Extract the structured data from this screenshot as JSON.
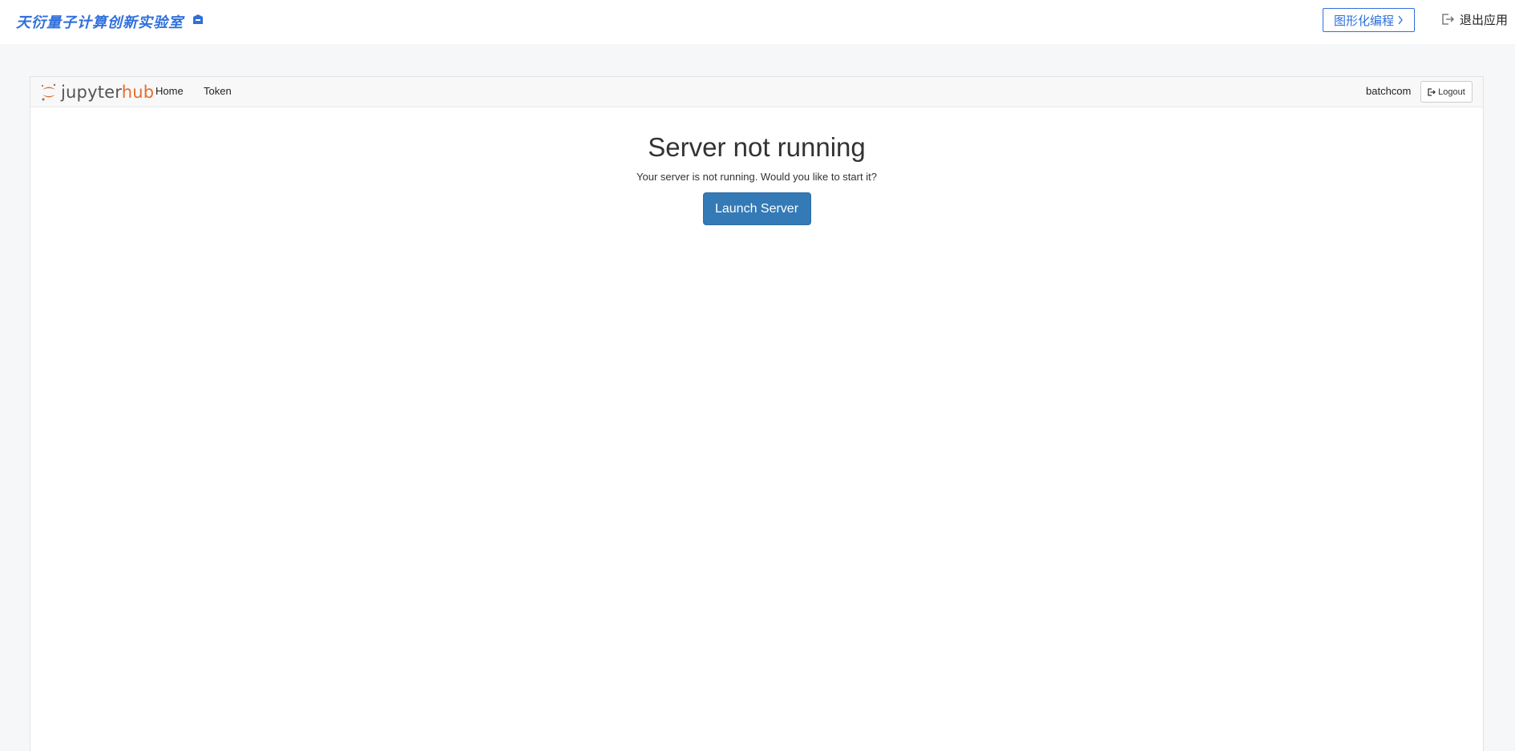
{
  "topbar": {
    "brand": "天衍量子计算创新实验室",
    "graphic_button_label": "图形化编程",
    "exit_label": "退出应用"
  },
  "jupyterhub": {
    "logo_part1": "jupyter",
    "logo_part2": "hub",
    "nav": [
      {
        "label": "Home"
      },
      {
        "label": "Token"
      }
    ],
    "username": "batchcom",
    "logout_label": "Logout"
  },
  "main": {
    "title": "Server not running",
    "message": "Your server is not running. Would you like to start it?",
    "launch_label": "Launch Server"
  },
  "colors": {
    "brand_blue": "#2f6fdc",
    "jupyter_orange": "#e46e2e",
    "primary_button": "#337ab7"
  }
}
